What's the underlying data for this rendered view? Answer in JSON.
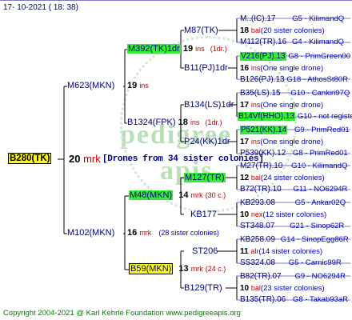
{
  "header": {
    "date": "17- 10-2021 ( 18: 38)"
  },
  "footer": {
    "copyright": "Copyright 2004-2021 @ Karl Kehrle Foundation    www.pedigreeapis.org"
  },
  "watermark": {
    "line1": "pedigree",
    "line2": "apis"
  },
  "colors": {
    "highlight_green": "#33ee33",
    "highlight_yellow": "#ffff00",
    "text_navy": "#000080",
    "ins_red": "#c00000",
    "rule_blue": "#7a7ac8"
  },
  "root": {
    "name": "B280(TK)",
    "count": "20",
    "unit": "mrk",
    "drones": "[Drones from 34 sister colonies]"
  },
  "gen1": {
    "upper": {
      "name": "M623(MKN)",
      "count": "19",
      "unit": "ins"
    },
    "lower": {
      "name": "M102(MKN)",
      "count": "16",
      "unit": "mrk",
      "note": "(28 sister colonies)"
    }
  },
  "gen2": {
    "a": {
      "name": "M392(TK)1dr",
      "count": "19",
      "unit": "ins",
      "note": "(1dr.)"
    },
    "b": {
      "name": "B1324(FPK)",
      "count": "18",
      "unit": "ins",
      "note": "(1dr.)"
    },
    "c": {
      "name": "M48(MKN)",
      "count": "14",
      "unit": "mrk",
      "note": "(30 c.)"
    },
    "d": {
      "name": "B59(MKN)",
      "count": "13",
      "unit": "mrk",
      "note": "(24 c.)"
    }
  },
  "gen3": {
    "a1": "M87(TK)",
    "a2": "B11(PJ)1dr",
    "b1": "B134(LS)1dr",
    "b2": "P24(KK)1dr",
    "c1": "M127(TR)",
    "c2": "KB177",
    "d1": "ST206",
    "d2": "B129(TR)"
  },
  "gen4": [
    {
      "name": "M..(IC).17",
      "tag": "G5 - KilimandQ"
    },
    {
      "count": "18",
      "unit": "bal",
      "desc": "(20 sister colonies)"
    },
    {
      "name": "M112(TR).16",
      "tag": "G4 - KilimandQ"
    },
    {
      "name": "V216(PJ).13",
      "tag": "G8 - PrimGreen00"
    },
    {
      "count": "16",
      "unit": "ins",
      "desc": "(One single drone)"
    },
    {
      "name": "B126(PJ).13",
      "tag": "G18 - AthosSt80R"
    },
    {
      "name": "B35(LS).15",
      "tag": "G10 - Cankiri97Q"
    },
    {
      "count": "17",
      "unit": "ins",
      "desc": "(One single drone)"
    },
    {
      "name": "B14Vf(RHO).13",
      "tag": "G10 - not registe"
    },
    {
      "name": "P521(KK).14",
      "tag": "G9 - PrimRed01"
    },
    {
      "count": "17",
      "unit": "ins",
      "desc": "(One single drone)"
    },
    {
      "name": "P539(KK).12",
      "tag": "G8 - PrimRed01"
    },
    {
      "name": "M27(TR).10",
      "tag": "G10 - KilimandQ"
    },
    {
      "count": "12",
      "unit": "bal",
      "desc": "(24 sister colonies)"
    },
    {
      "name": "B72(TR).10",
      "tag": "G11 - NO6294R"
    },
    {
      "name": "KB293.08",
      "tag": "G5 - Ankar02Q"
    },
    {
      "count": "10",
      "unit": "nex",
      "desc": "(12 sister colonies)"
    },
    {
      "name": "ST348.07",
      "tag": "G21 - Sinop62R"
    },
    {
      "name": "KB258.09",
      "tag": "G14 - SinopEgg86R"
    },
    {
      "count": "11",
      "unit": "alr",
      "desc": "(14 sister colonies)"
    },
    {
      "name": "SS324.08",
      "tag": "G5 - Carnic99R"
    },
    {
      "name": "B82(TR).07",
      "tag": "G9 - NO6294R"
    },
    {
      "count": "10",
      "unit": "bal",
      "desc": "(23 sister colonies)"
    },
    {
      "name": "B135(TR).06",
      "tag": "G8 - Takab93aR"
    }
  ]
}
